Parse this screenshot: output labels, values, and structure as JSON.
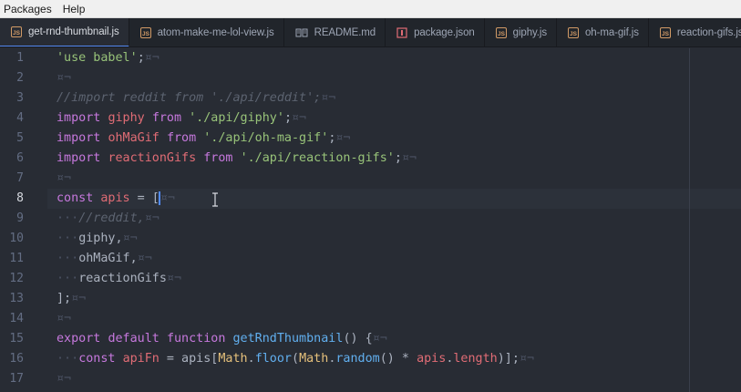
{
  "menubar": {
    "items": [
      "Packages",
      "Help"
    ]
  },
  "tabs": [
    {
      "label": "get-rnd-thumbnail.js",
      "icon": "js-file-icon",
      "active": true
    },
    {
      "label": "atom-make-me-lol-view.js",
      "icon": "js-file-icon",
      "active": false
    },
    {
      "label": "README.md",
      "icon": "book-icon",
      "active": false
    },
    {
      "label": "package.json",
      "icon": "package-icon",
      "active": false
    },
    {
      "label": "giphy.js",
      "icon": "js-file-icon",
      "active": false
    },
    {
      "label": "oh-ma-gif.js",
      "icon": "js-file-icon",
      "active": false
    },
    {
      "label": "reaction-gifs.js",
      "icon": "js-file-icon",
      "active": false
    }
  ],
  "editor": {
    "current_line": 8,
    "line_numbers": [
      "1",
      "2",
      "3",
      "4",
      "5",
      "6",
      "7",
      "8",
      "9",
      "10",
      "11",
      "12",
      "13",
      "14",
      "15",
      "16",
      "17"
    ],
    "eol_mark": "¤¬",
    "indent_mark": "···",
    "code": {
      "l1_str": "'use babel'",
      "l1_semi": ";",
      "l3_comment": "//import reddit from './api/reddit';",
      "l4_import": "import",
      "l4_name": "giphy",
      "l4_from": "from",
      "l4_path": "'./api/giphy'",
      "l4_semi": ";",
      "l5_import": "import",
      "l5_name": "ohMaGif",
      "l5_from": "from",
      "l5_path": "'./api/oh-ma-gif'",
      "l5_semi": ";",
      "l6_import": "import",
      "l6_name": "reactionGifs",
      "l6_from": "from",
      "l6_path": "'./api/reaction-gifs'",
      "l6_semi": ";",
      "l8_const": "const",
      "l8_name": "apis",
      "l8_rest": " = [",
      "l9_comment": "//reddit,",
      "l10_text": "giphy,",
      "l11_text": "ohMaGif,",
      "l12_text": "reactionGifs",
      "l13_text": "];",
      "l15_export": "export",
      "l15_default": "default",
      "l15_function": "function",
      "l15_fname": "getRndThumbnail",
      "l15_rest": "() {",
      "l16_const": "const",
      "l16_name": "apiFn",
      "l16_eq": " = apis[",
      "l16_math1": "Math",
      "l16_dot1": ".",
      "l16_floor": "floor",
      "l16_paren": "(",
      "l16_math2": "Math",
      "l16_dot2": ".",
      "l16_random": "random",
      "l16_mul": "() * ",
      "l16_apis": "apis",
      "l16_dot3": ".",
      "l16_length": "length",
      "l16_end": ")];"
    }
  },
  "colors": {
    "editor_bg": "#282c34",
    "tabbar_bg": "#21252b",
    "active_tab_accent": "#568af2",
    "keyword": "#c678dd",
    "string": "#98c379",
    "variable": "#e06c75",
    "function": "#61afef",
    "comment": "#5c6370"
  }
}
